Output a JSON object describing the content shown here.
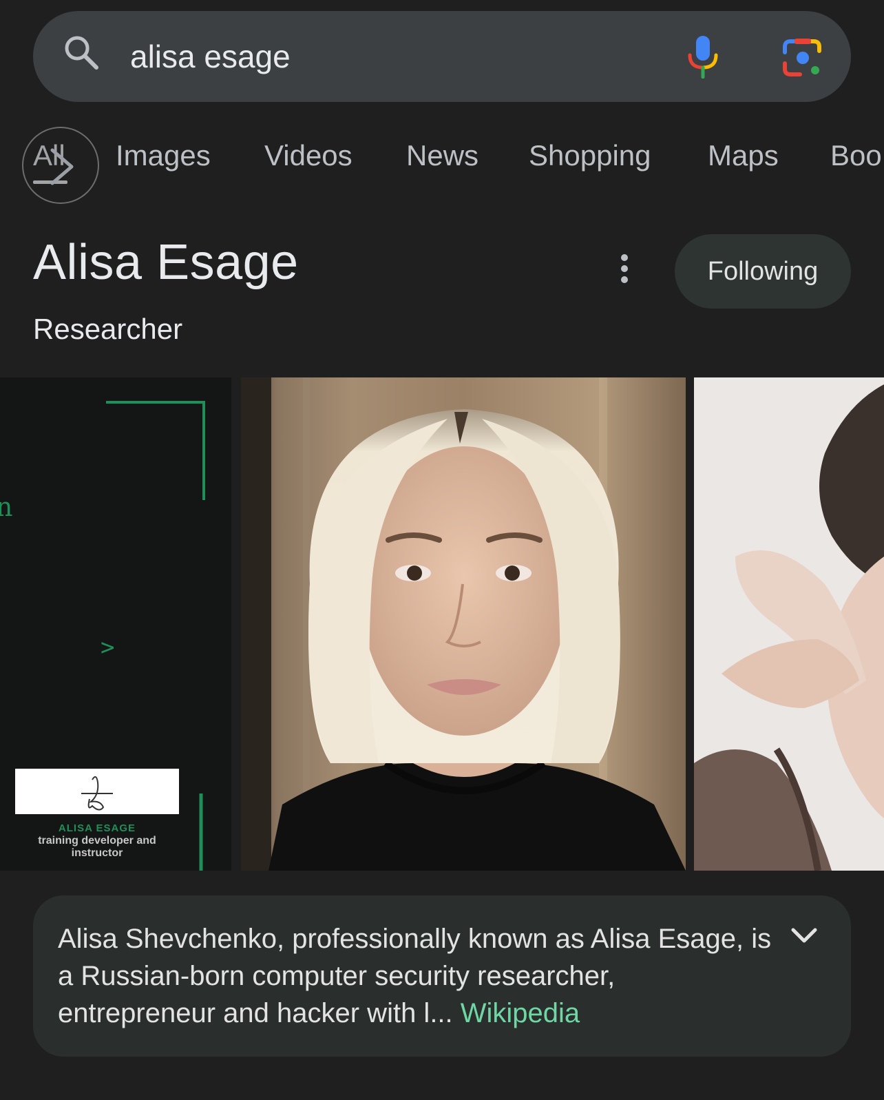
{
  "search": {
    "query": "alisa esage"
  },
  "tabs": [
    {
      "label": "All",
      "active": true
    },
    {
      "label": "Images"
    },
    {
      "label": "Videos"
    },
    {
      "label": "News"
    },
    {
      "label": "Shopping"
    },
    {
      "label": "Maps"
    },
    {
      "label": "Boo"
    }
  ],
  "knowledge_panel": {
    "title": "Alisa Esage",
    "subtitle": "Researcher",
    "follow_label": "Following",
    "images": {
      "first_caption_name": "ALISA ESAGE",
      "first_caption_text": "training developer and instructor",
      "first_partial_text": "n",
      "first_prompt_glyph": ">"
    },
    "description": "Alisa Shevchenko, professionally known as Alisa Esage, is a Russian-born computer security researcher, entrepreneur and hacker with l...",
    "source": "Wikipedia"
  },
  "colors": {
    "background": "#1f1f1f",
    "search_bar": "#3c4043",
    "follow_button": "#2d3431",
    "card": "#2a2f2e",
    "link": "#6fd6a4"
  },
  "icons": [
    "search-icon",
    "mic-icon",
    "lens-icon",
    "arrow-right-icon",
    "more-vert-icon",
    "chevron-down-icon"
  ]
}
